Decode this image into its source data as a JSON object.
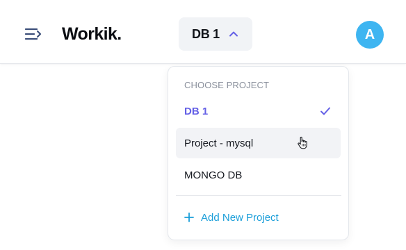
{
  "header": {
    "menu_icon": "menu-collapse-icon",
    "logo": "Workik.",
    "project_selector": {
      "label": "DB 1",
      "icon": "chevron-up-icon"
    },
    "avatar": {
      "initial": "A",
      "color": "#3eb5f1"
    }
  },
  "dropdown": {
    "heading": "CHOOSE PROJECT",
    "items": [
      {
        "label": "DB 1",
        "selected": true,
        "icon": "check-icon"
      },
      {
        "label": "Project - mysql",
        "hovered": true
      },
      {
        "label": "MONGO DB"
      }
    ],
    "add_button": {
      "label": "Add New Project",
      "icon": "plus-icon"
    },
    "colors": {
      "selected": "#6460e6",
      "accent": "#1a9ed9",
      "hover_bg": "#f2f3f6"
    }
  }
}
